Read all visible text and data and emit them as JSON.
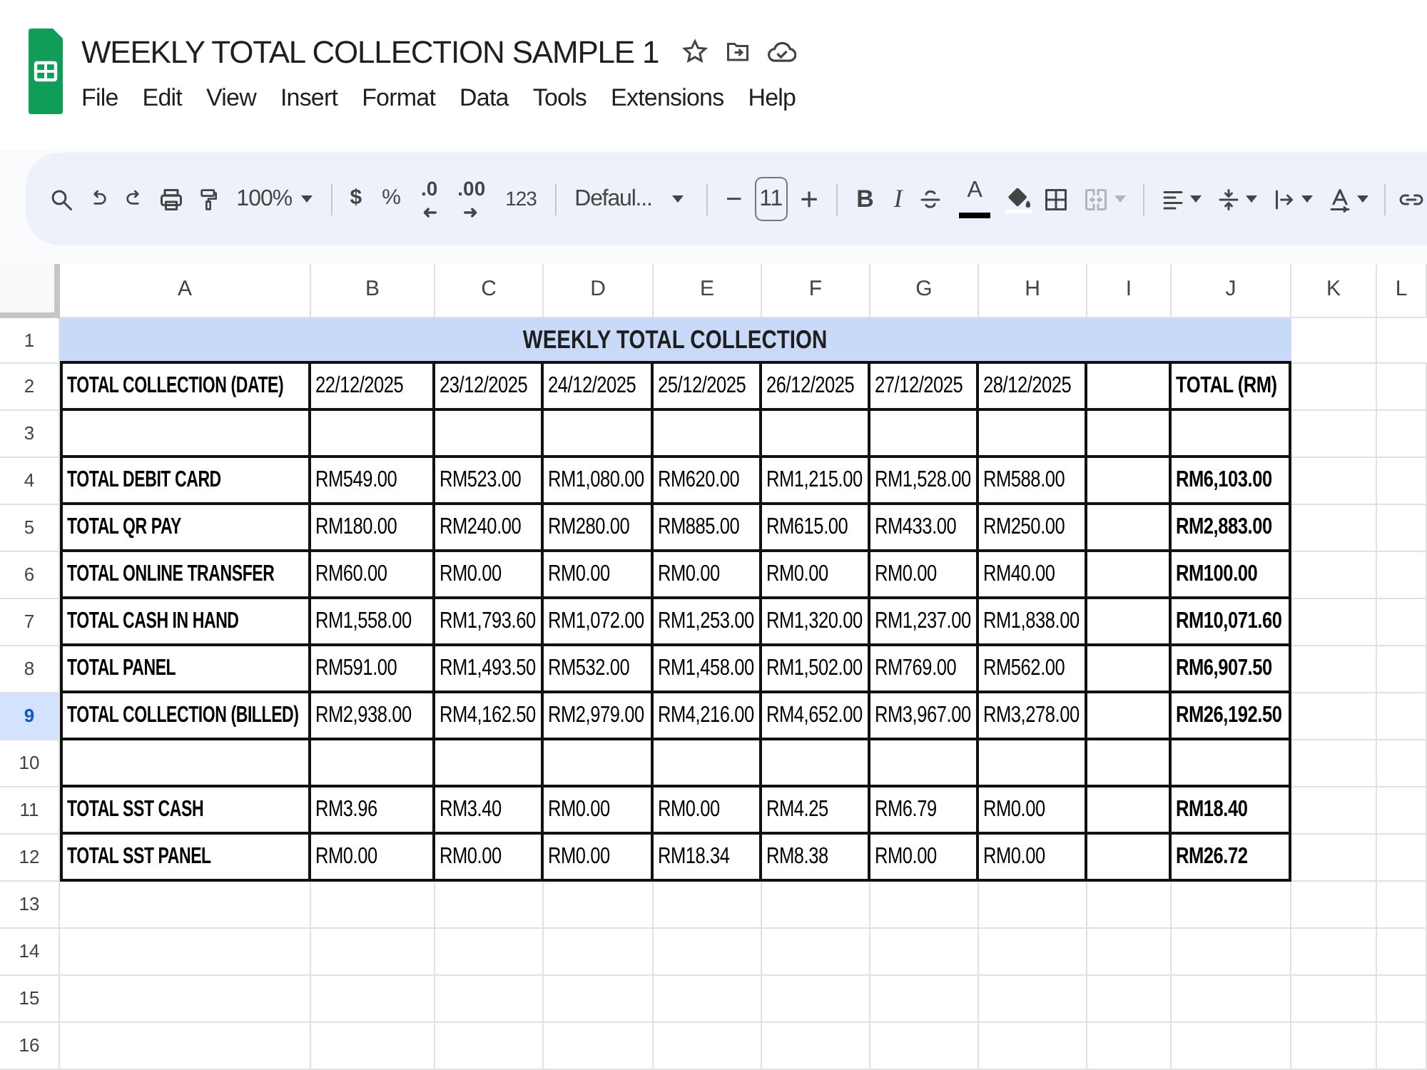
{
  "document": {
    "title": "WEEKLY TOTAL COLLECTION SAMPLE 1"
  },
  "menu": [
    "File",
    "Edit",
    "View",
    "Insert",
    "Format",
    "Data",
    "Tools",
    "Extensions",
    "Help"
  ],
  "toolbar": {
    "zoom": "100%",
    "currency": "$",
    "percent": "%",
    "decrease_decimal": ".0",
    "increase_decimal": ".00",
    "number_format": "123",
    "font": "Defaul...",
    "decrease_size": "−",
    "font_size": "11",
    "increase_size": "+",
    "bold": "B",
    "italic": "I",
    "text_color": "A",
    "merge_disabled": true
  },
  "sheet": {
    "columns": [
      {
        "label": "A",
        "selected": false
      },
      {
        "label": "B",
        "selected": false
      },
      {
        "label": "C",
        "selected": false
      },
      {
        "label": "D",
        "selected": false
      },
      {
        "label": "E",
        "selected": false
      },
      {
        "label": "F",
        "selected": false
      },
      {
        "label": "G",
        "selected": false
      },
      {
        "label": "H",
        "selected": false
      },
      {
        "label": "I",
        "selected": false
      },
      {
        "label": "J",
        "selected": false
      },
      {
        "label": "K",
        "selected": false
      },
      {
        "label": "L",
        "selected": false
      }
    ],
    "rows": [
      {
        "number": "1",
        "selected": false,
        "kind": "title",
        "title": "WEEKLY TOTAL COLLECTION"
      },
      {
        "number": "2",
        "selected": false,
        "kind": "table",
        "cells": {
          "A": "TOTAL COLLECTION (DATE)",
          "B": "22/12/2025",
          "C": "23/12/2025",
          "D": "24/12/2025",
          "E": "25/12/2025",
          "F": "26/12/2025",
          "G": "27/12/2025",
          "H": "28/12/2025",
          "J": "TOTAL (RM)"
        }
      },
      {
        "number": "3",
        "selected": false,
        "kind": "table",
        "cells": {}
      },
      {
        "number": "4",
        "selected": false,
        "kind": "table",
        "cells": {
          "A": "TOTAL DEBIT CARD",
          "B": "RM549.00",
          "C": "RM523.00",
          "D": "RM1,080.00",
          "E": "RM620.00",
          "F": "RM1,215.00",
          "G": "RM1,528.00",
          "H": "RM588.00",
          "J": "RM6,103.00"
        }
      },
      {
        "number": "5",
        "selected": false,
        "kind": "table",
        "cells": {
          "A": "TOTAL QR PAY",
          "B": "RM180.00",
          "C": "RM240.00",
          "D": "RM280.00",
          "E": "RM885.00",
          "F": "RM615.00",
          "G": "RM433.00",
          "H": "RM250.00",
          "J": "RM2,883.00"
        }
      },
      {
        "number": "6",
        "selected": false,
        "kind": "table",
        "cells": {
          "A": "TOTAL ONLINE TRANSFER",
          "B": "RM60.00",
          "C": "RM0.00",
          "D": "RM0.00",
          "E": "RM0.00",
          "F": "RM0.00",
          "G": "RM0.00",
          "H": "RM40.00",
          "J": "RM100.00"
        }
      },
      {
        "number": "7",
        "selected": false,
        "kind": "table",
        "cells": {
          "A": "TOTAL CASH IN HAND",
          "B": "RM1,558.00",
          "C": "RM1,793.60",
          "D": "RM1,072.00",
          "E": "RM1,253.00",
          "F": "RM1,320.00",
          "G": "RM1,237.00",
          "H": "RM1,838.00",
          "J": "RM10,071.60"
        }
      },
      {
        "number": "8",
        "selected": false,
        "kind": "table",
        "cells": {
          "A": "TOTAL PANEL",
          "B": "RM591.00",
          "C": "RM1,493.50",
          "D": "RM532.00",
          "E": "RM1,458.00",
          "F": "RM1,502.00",
          "G": "RM769.00",
          "H": "RM562.00",
          "J": "RM6,907.50"
        }
      },
      {
        "number": "9",
        "selected": true,
        "kind": "table",
        "cells": {
          "A": "TOTAL COLLECTION (BILLED)",
          "B": "RM2,938.00",
          "C": "RM4,162.50",
          "D": "RM2,979.00",
          "E": "RM4,216.00",
          "F": "RM4,652.00",
          "G": "RM3,967.00",
          "H": "RM3,278.00",
          "J": "RM26,192.50"
        }
      },
      {
        "number": "10",
        "selected": false,
        "kind": "table",
        "cells": {}
      },
      {
        "number": "11",
        "selected": false,
        "kind": "table",
        "cells": {
          "A": "TOTAL SST CASH",
          "B": "RM3.96",
          "C": "RM3.40",
          "D": "RM0.00",
          "E": "RM0.00",
          "F": "RM4.25",
          "G": "RM6.79",
          "H": "RM0.00",
          "J": "RM18.40"
        }
      },
      {
        "number": "12",
        "selected": false,
        "kind": "table",
        "cells": {
          "A": "TOTAL SST PANEL",
          "B": "RM0.00",
          "C": "RM0.00",
          "D": "RM0.00",
          "E": "RM18.34",
          "F": "RM8.38",
          "G": "RM0.00",
          "H": "RM0.00",
          "J": "RM26.72"
        }
      },
      {
        "number": "13",
        "selected": false,
        "kind": "empty"
      },
      {
        "number": "14",
        "selected": false,
        "kind": "empty"
      },
      {
        "number": "15",
        "selected": false,
        "kind": "empty"
      },
      {
        "number": "16",
        "selected": false,
        "kind": "empty"
      }
    ]
  }
}
